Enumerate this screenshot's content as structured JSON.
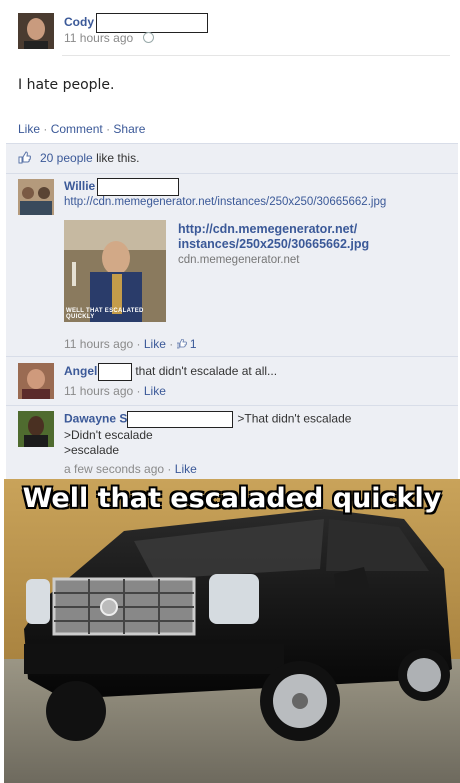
{
  "post": {
    "author": "Cody",
    "timestamp": "11 hours ago",
    "privacy_icon": "globe-icon",
    "text": "I hate people.",
    "actions": {
      "like": "Like",
      "comment": "Comment",
      "share": "Share",
      "sep": "·"
    },
    "likes_count": "20 people",
    "likes_suffix": "like this."
  },
  "comments": [
    {
      "author": "Willie",
      "text": "http://cdn.memegenerator.net/instances/250x250/30665662.jpg",
      "preview": {
        "title_line1": "http://cdn.memegenerator.net/",
        "title_line2": "instances/250x250/30665662.jpg",
        "domain": "cdn.memegenerator.net",
        "thumb_caption": "WELL THAT ESCALATED QUICKLY"
      },
      "timestamp": "11 hours ago",
      "like": "Like",
      "like_count": "1"
    },
    {
      "author": "Angel",
      "text": "that didn't escalade at all...",
      "timestamp": "11 hours ago",
      "like": "Like"
    },
    {
      "author": "Dawayne S",
      "text_line1": ">That didn't escalade",
      "text_line2": ">Didn't escalade",
      "text_line3": ">escalade",
      "timestamp": "a few seconds ago",
      "like": "Like"
    }
  ],
  "meme": {
    "caption": "Well that escaladed quickly"
  },
  "colors": {
    "link": "#3b5998",
    "comment_bg": "#edeff4"
  }
}
